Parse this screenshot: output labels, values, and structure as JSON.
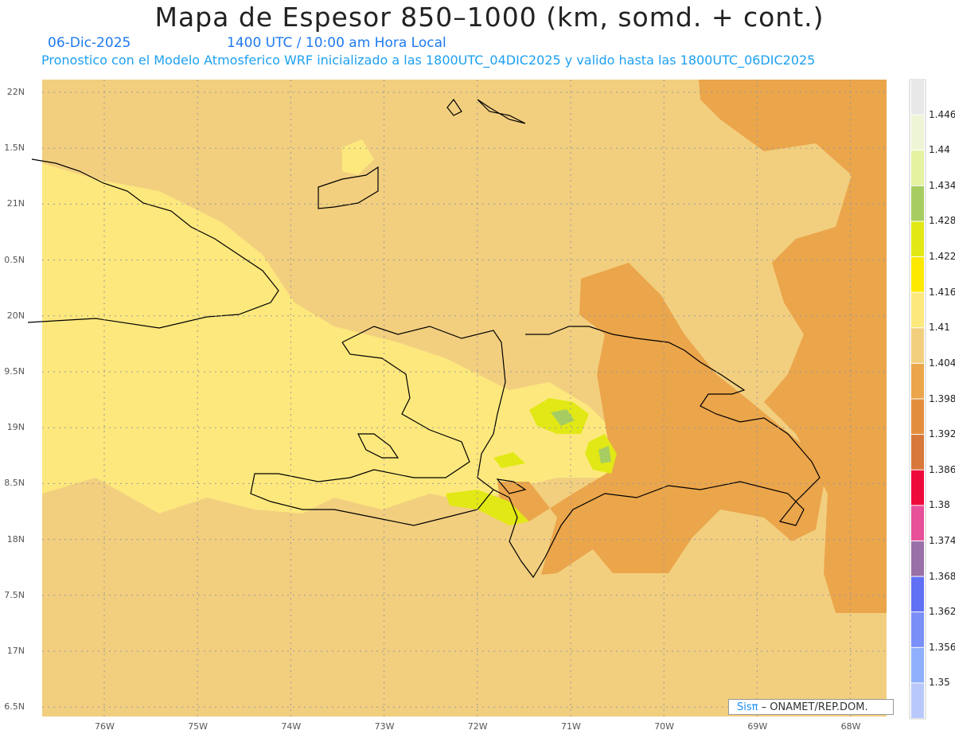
{
  "header": {
    "title": "Mapa de Espesor 850–1000 (km, somd. + cont.)",
    "date": "06-Dic-2025",
    "time": "1400 UTC / 10:00 am Hora Local",
    "subtitle": "Pronostico con el Modelo Atmosferico WRF inicializado a las 1800UTC_04DIC2025 y valido hasta las  1800UTC_06DIC2025"
  },
  "map": {
    "background_color": "#f2cf7f",
    "lat_labels": [
      "22N",
      "1.5N",
      "21N",
      "0.5N",
      "20N",
      "9.5N",
      "19N",
      "8.5N",
      "18N",
      "7.5N",
      "17N",
      "6.5N"
    ],
    "lon_labels": [
      "76W",
      "75W",
      "74W",
      "73W",
      "72W",
      "71W",
      "70W",
      "69W",
      "68W"
    ]
  },
  "colorbar": {
    "colors": [
      "#e8e8e8",
      "#eef5d6",
      "#e5f2a0",
      "#a7cc62",
      "#e1e815",
      "#fde800",
      "#fde87d",
      "#f2cf7f",
      "#eba54b",
      "#e38e3e",
      "#d7793a",
      "#ef0a3c",
      "#e8509a",
      "#9a70a8",
      "#6270f5",
      "#7b8ff8",
      "#8fb0fc",
      "#b8c8fb"
    ],
    "labels": [
      "1.446",
      "1.44",
      "1.434",
      "1.428",
      "1.422",
      "1.416",
      "1.41",
      "1.404",
      "1.398",
      "1.392",
      "1.386",
      "1.38",
      "1.374",
      "1.368",
      "1.362",
      "1.356",
      "1.35"
    ]
  },
  "credit": {
    "logo": "Sisπ",
    "text": " –  ONAMET/REP.DOM."
  }
}
